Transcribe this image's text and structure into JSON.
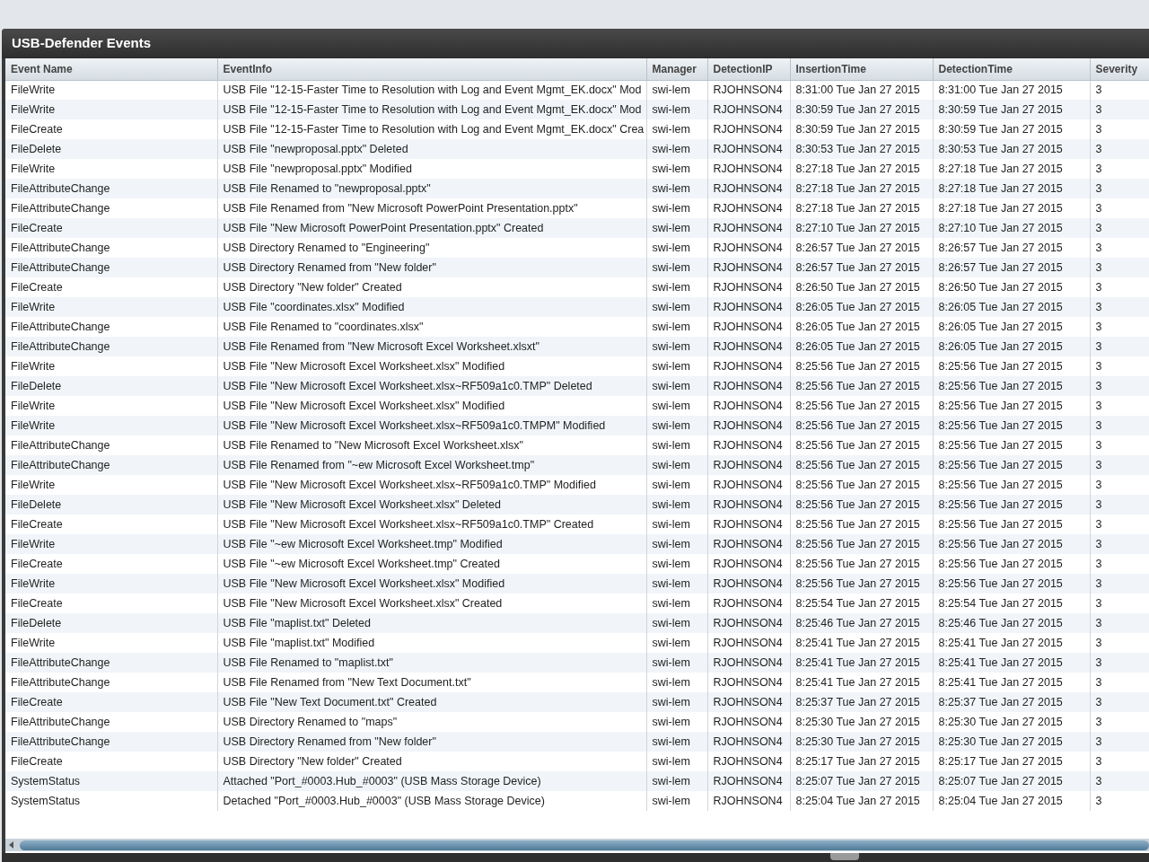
{
  "window": {
    "title": "USB-Defender Events"
  },
  "table": {
    "columns": [
      "Event Name",
      "EventInfo",
      "Manager",
      "DetectionIP",
      "InsertionTime",
      "DetectionTime",
      "Severity"
    ],
    "rows": [
      [
        "FileWrite",
        "USB File \"12-15-Faster Time to Resolution with Log and Event Mgmt_EK.docx\" Mod",
        "swi-lem",
        "RJOHNSON4",
        "8:31:00 Tue Jan 27 2015",
        "8:31:00 Tue Jan 27 2015",
        "3"
      ],
      [
        "FileWrite",
        "USB File \"12-15-Faster Time to Resolution with Log and Event Mgmt_EK.docx\" Mod",
        "swi-lem",
        "RJOHNSON4",
        "8:30:59 Tue Jan 27 2015",
        "8:30:59 Tue Jan 27 2015",
        "3"
      ],
      [
        "FileCreate",
        "USB File \"12-15-Faster Time to Resolution with Log and Event Mgmt_EK.docx\" Crea",
        "swi-lem",
        "RJOHNSON4",
        "8:30:59 Tue Jan 27 2015",
        "8:30:59 Tue Jan 27 2015",
        "3"
      ],
      [
        "FileDelete",
        "USB File \"newproposal.pptx\" Deleted",
        "swi-lem",
        "RJOHNSON4",
        "8:30:53 Tue Jan 27 2015",
        "8:30:53 Tue Jan 27 2015",
        "3"
      ],
      [
        "FileWrite",
        "USB File \"newproposal.pptx\" Modified",
        "swi-lem",
        "RJOHNSON4",
        "8:27:18 Tue Jan 27 2015",
        "8:27:18 Tue Jan 27 2015",
        "3"
      ],
      [
        "FileAttributeChange",
        "USB File Renamed to \"newproposal.pptx\"",
        "swi-lem",
        "RJOHNSON4",
        "8:27:18 Tue Jan 27 2015",
        "8:27:18 Tue Jan 27 2015",
        "3"
      ],
      [
        "FileAttributeChange",
        "USB File Renamed from \"New Microsoft PowerPoint Presentation.pptx\"",
        "swi-lem",
        "RJOHNSON4",
        "8:27:18 Tue Jan 27 2015",
        "8:27:18 Tue Jan 27 2015",
        "3"
      ],
      [
        "FileCreate",
        "USB File \"New Microsoft PowerPoint Presentation.pptx\" Created",
        "swi-lem",
        "RJOHNSON4",
        "8:27:10 Tue Jan 27 2015",
        "8:27:10 Tue Jan 27 2015",
        "3"
      ],
      [
        "FileAttributeChange",
        "USB Directory Renamed to \"Engineering\"",
        "swi-lem",
        "RJOHNSON4",
        "8:26:57 Tue Jan 27 2015",
        "8:26:57 Tue Jan 27 2015",
        "3"
      ],
      [
        "FileAttributeChange",
        "USB Directory Renamed from \"New folder\"",
        "swi-lem",
        "RJOHNSON4",
        "8:26:57 Tue Jan 27 2015",
        "8:26:57 Tue Jan 27 2015",
        "3"
      ],
      [
        "FileCreate",
        "USB Directory \"New folder\" Created",
        "swi-lem",
        "RJOHNSON4",
        "8:26:50 Tue Jan 27 2015",
        "8:26:50 Tue Jan 27 2015",
        "3"
      ],
      [
        "FileWrite",
        "USB File \"coordinates.xlsx\" Modified",
        "swi-lem",
        "RJOHNSON4",
        "8:26:05 Tue Jan 27 2015",
        "8:26:05 Tue Jan 27 2015",
        "3"
      ],
      [
        "FileAttributeChange",
        "USB File Renamed to \"coordinates.xlsx\"",
        "swi-lem",
        "RJOHNSON4",
        "8:26:05 Tue Jan 27 2015",
        "8:26:05 Tue Jan 27 2015",
        "3"
      ],
      [
        "FileAttributeChange",
        "USB File Renamed from \"New Microsoft Excel Worksheet.xlsxt\"",
        "swi-lem",
        "RJOHNSON4",
        "8:26:05 Tue Jan 27 2015",
        "8:26:05 Tue Jan 27 2015",
        "3"
      ],
      [
        "FileWrite",
        "USB File \"New Microsoft Excel Worksheet.xlsx\" Modified",
        "swi-lem",
        "RJOHNSON4",
        "8:25:56 Tue Jan 27 2015",
        "8:25:56 Tue Jan 27 2015",
        "3"
      ],
      [
        "FileDelete",
        "USB File \"New Microsoft Excel Worksheet.xlsx~RF509a1c0.TMP\" Deleted",
        "swi-lem",
        "RJOHNSON4",
        "8:25:56 Tue Jan 27 2015",
        "8:25:56 Tue Jan 27 2015",
        "3"
      ],
      [
        "FileWrite",
        "USB File \"New Microsoft Excel Worksheet.xlsx\" Modified",
        "swi-lem",
        "RJOHNSON4",
        "8:25:56 Tue Jan 27 2015",
        "8:25:56 Tue Jan 27 2015",
        "3"
      ],
      [
        "FileWrite",
        "USB File \"New Microsoft Excel Worksheet.xlsx~RF509a1c0.TMPM\" Modified",
        "swi-lem",
        "RJOHNSON4",
        "8:25:56 Tue Jan 27 2015",
        "8:25:56 Tue Jan 27 2015",
        "3"
      ],
      [
        "FileAttributeChange",
        "USB File Renamed to \"New Microsoft Excel Worksheet.xlsx\"",
        "swi-lem",
        "RJOHNSON4",
        "8:25:56 Tue Jan 27 2015",
        "8:25:56 Tue Jan 27 2015",
        "3"
      ],
      [
        "FileAttributeChange",
        "USB File Renamed from \"~ew Microsoft Excel Worksheet.tmp\"",
        "swi-lem",
        "RJOHNSON4",
        "8:25:56 Tue Jan 27 2015",
        "8:25:56 Tue Jan 27 2015",
        "3"
      ],
      [
        "FileWrite",
        "USB File \"New Microsoft Excel Worksheet.xlsx~RF509a1c0.TMP\" Modified",
        "swi-lem",
        "RJOHNSON4",
        "8:25:56 Tue Jan 27 2015",
        "8:25:56 Tue Jan 27 2015",
        "3"
      ],
      [
        "FileDelete",
        "USB File \"New Microsoft Excel Worksheet.xlsx\" Deleted",
        "swi-lem",
        "RJOHNSON4",
        "8:25:56 Tue Jan 27 2015",
        "8:25:56 Tue Jan 27 2015",
        "3"
      ],
      [
        "FileCreate",
        "USB File \"New Microsoft Excel Worksheet.xlsx~RF509a1c0.TMP\" Created",
        "swi-lem",
        "RJOHNSON4",
        "8:25:56 Tue Jan 27 2015",
        "8:25:56 Tue Jan 27 2015",
        "3"
      ],
      [
        "FileWrite",
        "USB File \"~ew Microsoft Excel Worksheet.tmp\" Modified",
        "swi-lem",
        "RJOHNSON4",
        "8:25:56 Tue Jan 27 2015",
        "8:25:56 Tue Jan 27 2015",
        "3"
      ],
      [
        "FileCreate",
        "USB File \"~ew Microsoft Excel Worksheet.tmp\" Created",
        "swi-lem",
        "RJOHNSON4",
        "8:25:56 Tue Jan 27 2015",
        "8:25:56 Tue Jan 27 2015",
        "3"
      ],
      [
        "FileWrite",
        "USB File \"New Microsoft Excel Worksheet.xlsx\" Modified",
        "swi-lem",
        "RJOHNSON4",
        "8:25:56 Tue Jan 27 2015",
        "8:25:56 Tue Jan 27 2015",
        "3"
      ],
      [
        "FileCreate",
        "USB File \"New Microsoft Excel Worksheet.xlsx\" Created",
        "swi-lem",
        "RJOHNSON4",
        "8:25:54 Tue Jan 27 2015",
        "8:25:54 Tue Jan 27 2015",
        "3"
      ],
      [
        "FileDelete",
        "USB File \"maplist.txt\" Deleted",
        "swi-lem",
        "RJOHNSON4",
        "8:25:46 Tue Jan 27 2015",
        "8:25:46 Tue Jan 27 2015",
        "3"
      ],
      [
        "FileWrite",
        "USB File \"maplist.txt\" Modified",
        "swi-lem",
        "RJOHNSON4",
        "8:25:41 Tue Jan 27 2015",
        "8:25:41 Tue Jan 27 2015",
        "3"
      ],
      [
        "FileAttributeChange",
        "USB File Renamed to \"maplist.txt\"",
        "swi-lem",
        "RJOHNSON4",
        "8:25:41 Tue Jan 27 2015",
        "8:25:41 Tue Jan 27 2015",
        "3"
      ],
      [
        "FileAttributeChange",
        "USB File Renamed from \"New Text Document.txt\"",
        "swi-lem",
        "RJOHNSON4",
        "8:25:41 Tue Jan 27 2015",
        "8:25:41 Tue Jan 27 2015",
        "3"
      ],
      [
        "FileCreate",
        "USB File \"New Text Document.txt\" Created",
        "swi-lem",
        "RJOHNSON4",
        "8:25:37 Tue Jan 27 2015",
        "8:25:37 Tue Jan 27 2015",
        "3"
      ],
      [
        "FileAttributeChange",
        "USB Directory Renamed to \"maps\"",
        "swi-lem",
        "RJOHNSON4",
        "8:25:30 Tue Jan 27 2015",
        "8:25:30 Tue Jan 27 2015",
        "3"
      ],
      [
        "FileAttributeChange",
        "USB Directory Renamed from \"New folder\"",
        "swi-lem",
        "RJOHNSON4",
        "8:25:30 Tue Jan 27 2015",
        "8:25:30 Tue Jan 27 2015",
        "3"
      ],
      [
        "FileCreate",
        "USB Directory \"New folder\" Created",
        "swi-lem",
        "RJOHNSON4",
        "8:25:17 Tue Jan 27 2015",
        "8:25:17 Tue Jan 27 2015",
        "3"
      ],
      [
        "SystemStatus",
        "Attached \"Port_#0003.Hub_#0003\" (USB Mass Storage Device)",
        "swi-lem",
        "RJOHNSON4",
        "8:25:07 Tue Jan 27 2015",
        "8:25:07 Tue Jan 27 2015",
        "3"
      ],
      [
        "SystemStatus",
        "Detached \"Port_#0003.Hub_#0003\" (USB Mass Storage Device)",
        "swi-lem",
        "RJOHNSON4",
        "8:25:04 Tue Jan 27 2015",
        "8:25:04 Tue Jan 27 2015",
        "3"
      ]
    ]
  }
}
